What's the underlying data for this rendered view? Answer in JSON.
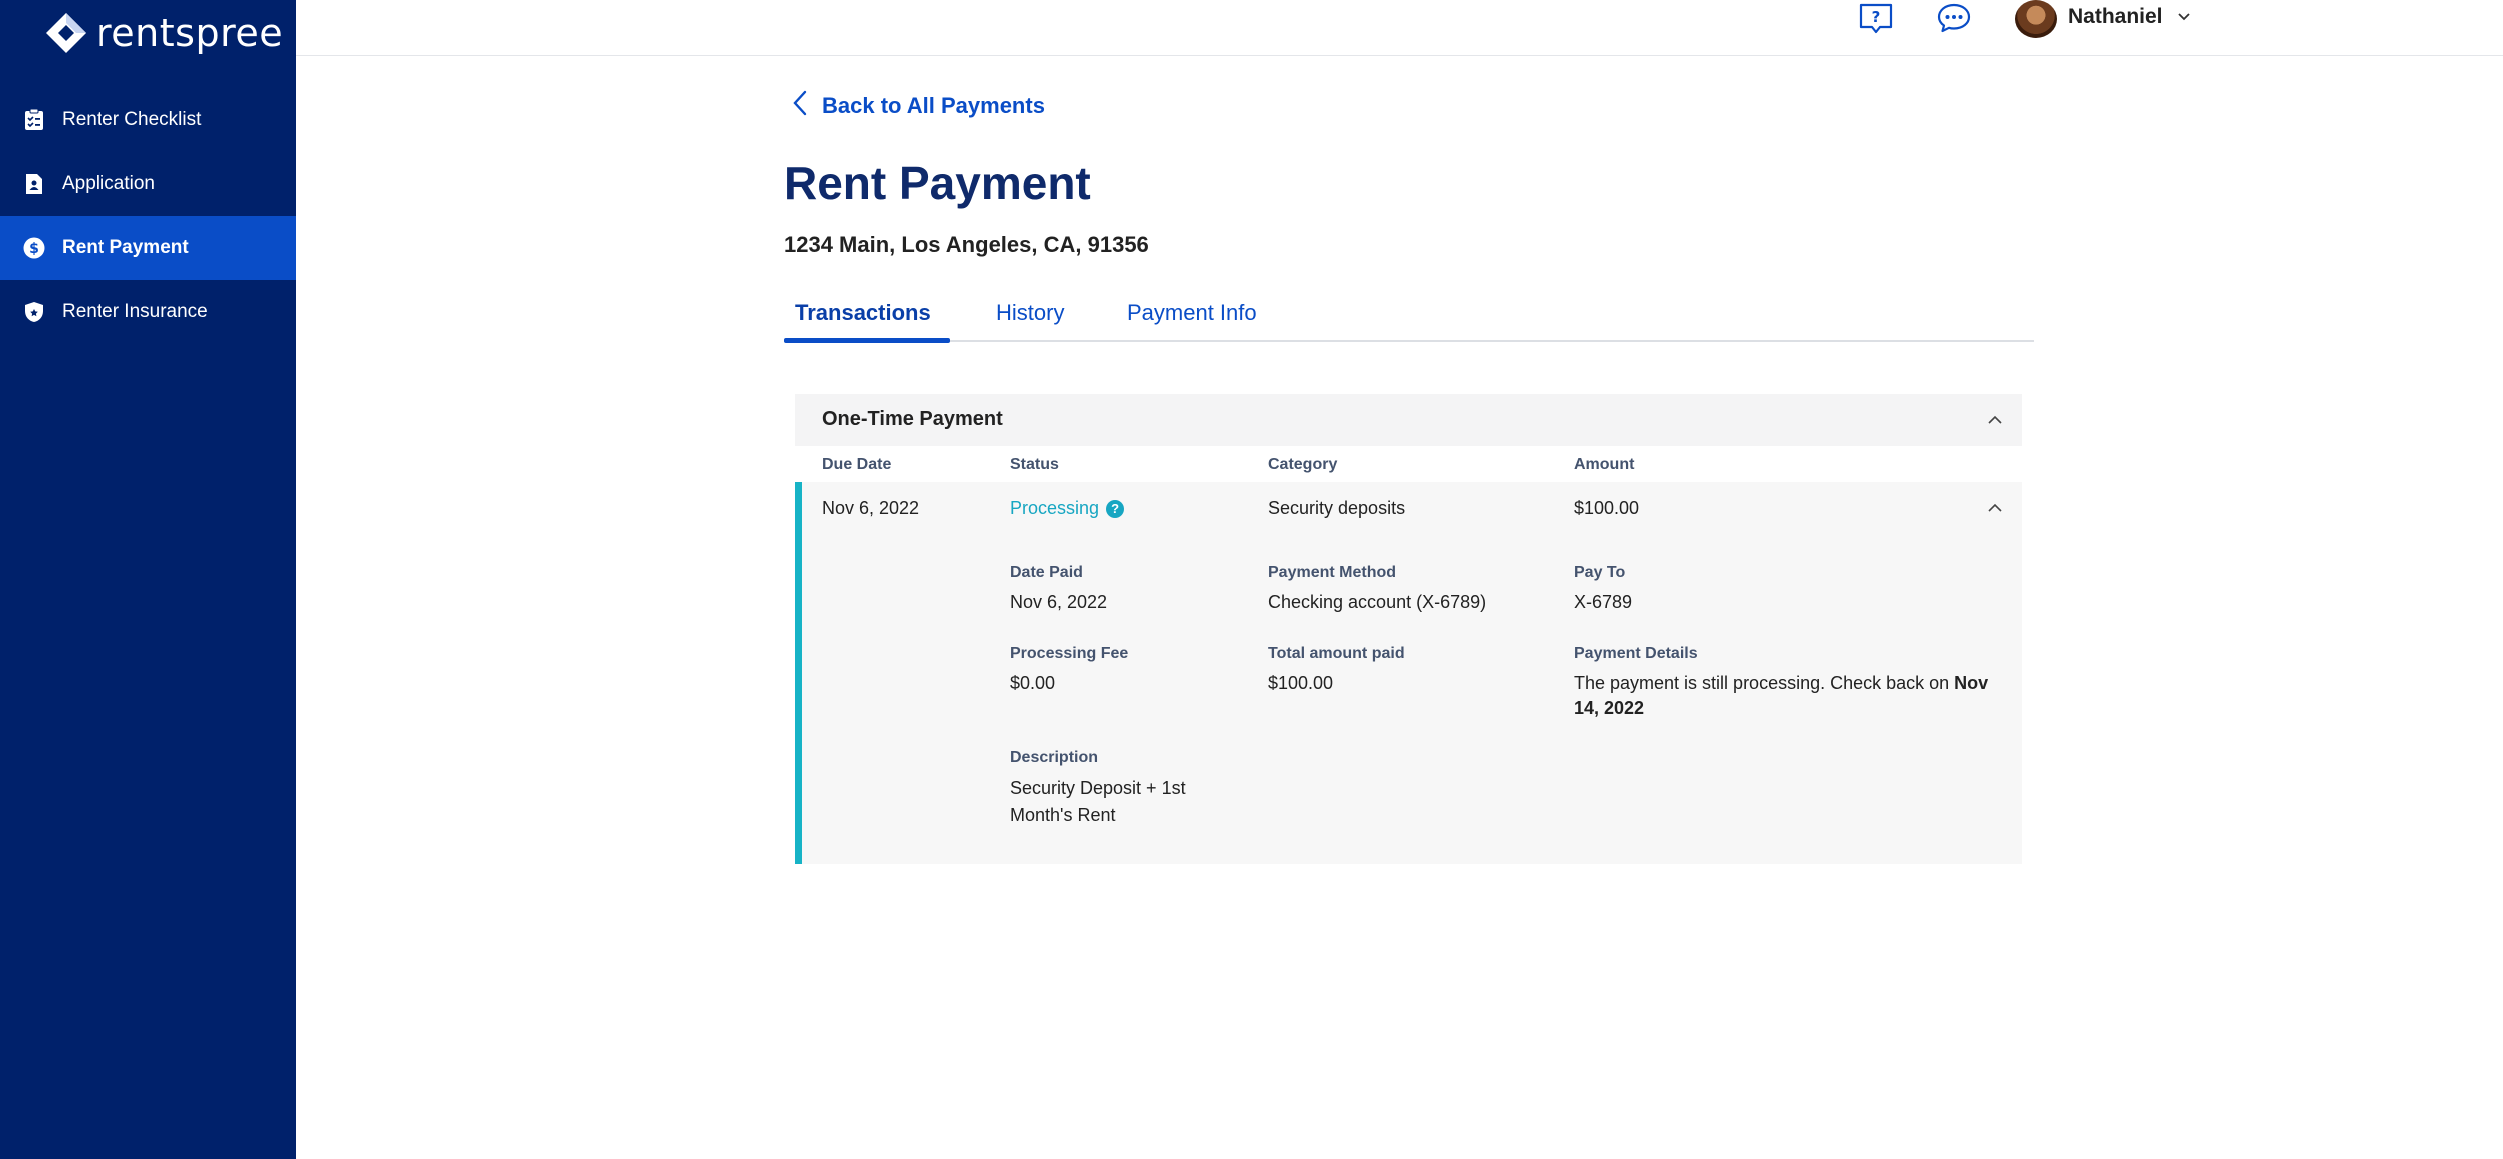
{
  "brand": {
    "name": "rentspree"
  },
  "sidebar": {
    "items": [
      {
        "label": "Renter Checklist",
        "icon": "checklist-icon"
      },
      {
        "label": "Application",
        "icon": "application-icon"
      },
      {
        "label": "Rent Payment",
        "icon": "dollar-icon",
        "active": true
      },
      {
        "label": "Renter Insurance",
        "icon": "shield-icon"
      }
    ]
  },
  "topbar": {
    "user_name": "Nathaniel"
  },
  "page": {
    "back_label": "Back to All Payments",
    "title": "Rent Payment",
    "address": "1234 Main, Los Angeles, CA, 91356",
    "tabs": [
      {
        "label": "Transactions",
        "active": true
      },
      {
        "label": "History"
      },
      {
        "label": "Payment Info"
      }
    ]
  },
  "card": {
    "title": "One-Time Payment",
    "columns": [
      "Due Date",
      "Status",
      "Category",
      "Amount"
    ],
    "row": {
      "due_date": "Nov 6, 2022",
      "status": "Processing",
      "category": "Security deposits",
      "amount": "$100.00"
    },
    "details": {
      "date_paid_label": "Date Paid",
      "date_paid": "Nov 6, 2022",
      "payment_method_label": "Payment Method",
      "payment_method": "Checking account (X-6789)",
      "pay_to_label": "Pay To",
      "pay_to": "X-6789",
      "processing_fee_label": "Processing Fee",
      "processing_fee": "$0.00",
      "total_paid_label": "Total amount paid",
      "total_paid": "$100.00",
      "payment_details_label": "Payment Details",
      "payment_details_text": "The payment is still processing. Check back on ",
      "payment_details_date": "Nov 14, 2022",
      "description_label": "Description",
      "description": "Security Deposit + 1st Month's Rent"
    }
  },
  "colors": {
    "sidebar_bg": "#00216b",
    "sidebar_active": "#0a4dc7",
    "accent": "#0a4dc7",
    "status_processing": "#17a6c2"
  }
}
